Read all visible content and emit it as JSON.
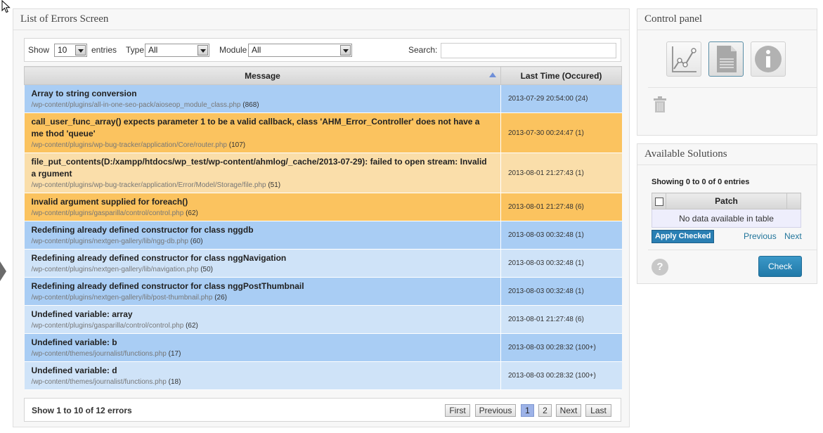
{
  "errors_panel": {
    "title": "List of Errors Screen",
    "show_label": "Show",
    "entries_value": "10",
    "entries_label": "entries",
    "type_label": "Type",
    "type_value": "All",
    "module_label": "Module",
    "module_value": "All",
    "search_label": "Search:",
    "search_value": "",
    "columns": [
      "Message",
      "Last Time (Occured)"
    ],
    "rows": [
      {
        "title": "Array to string conversion",
        "path": "/wp-content/plugins/all-in-one-seo-pack/aioseop_module_class.php",
        "line": "(868)",
        "time": "2013-07-29 20:54:00 (24)"
      },
      {
        "title": "call_user_func_array() expects parameter 1 to be a valid callback, class 'AHM_Error_Controller' does not have a me thod 'queue'",
        "path": "/wp-content/plugins/wp-bug-tracker/application/Core/router.php",
        "line": "(107)",
        "time": "2013-07-30 00:24:47 (1)"
      },
      {
        "title": "file_put_contents(D:/xampp/htdocs/wp_test/wp-content/ahmlog/_cache/2013-07-29): failed to open stream: Invalid a rgument",
        "path": "/wp-content/plugins/wp-bug-tracker/application/Error/Model/Storage/file.php",
        "line": "(51)",
        "time": "2013-08-01 21:27:43 (1)"
      },
      {
        "title": "Invalid argument supplied for foreach()",
        "path": "/wp-content/plugins/gasparilla/control/control.php",
        "line": "(62)",
        "time": "2013-08-01 21:27:48 (6)"
      },
      {
        "title": "Redefining already defined constructor for class nggdb",
        "path": "/wp-content/plugins/nextgen-gallery/lib/ngg-db.php",
        "line": "(60)",
        "time": "2013-08-03 00:32:48 (1)"
      },
      {
        "title": "Redefining already defined constructor for class nggNavigation",
        "path": "/wp-content/plugins/nextgen-gallery/lib/navigation.php",
        "line": "(50)",
        "time": "2013-08-03 00:32:48 (1)"
      },
      {
        "title": "Redefining already defined constructor for class nggPostThumbnail",
        "path": "/wp-content/plugins/nextgen-gallery/lib/post-thumbnail.php",
        "line": "(26)",
        "time": "2013-08-03 00:32:48 (1)"
      },
      {
        "title": "Undefined variable: array",
        "path": "/wp-content/plugins/gasparilla/control/control.php",
        "line": "(62)",
        "time": "2013-08-01 21:27:48 (6)"
      },
      {
        "title": "Undefined variable: b",
        "path": "/wp-content/themes/journalist/functions.php",
        "line": "(17)",
        "time": "2013-08-03 00:28:32 (100+)"
      },
      {
        "title": "Undefined variable: d",
        "path": "/wp-content/themes/journalist/functions.php",
        "line": "(18)",
        "time": "2013-08-03 00:28:32 (100+)"
      }
    ],
    "footer_info": "Show 1 to 10 of 12 errors",
    "pagination": {
      "first": "First",
      "previous": "Previous",
      "pages": [
        "1",
        "2"
      ],
      "next": "Next",
      "last": "Last"
    }
  },
  "control_panel": {
    "title": "Control panel",
    "icons": [
      "chart-icon",
      "document-icon",
      "info-icon",
      "trash-icon"
    ]
  },
  "solutions_panel": {
    "title": "Available Solutions",
    "info": "Showing 0 to 0 of 0 entries",
    "column": "Patch",
    "empty": "No data available in table",
    "apply_label": "Apply Checked",
    "previous": "Previous",
    "next": "Next",
    "help_glyph": "?",
    "check_label": "Check"
  },
  "colors": {
    "row_blue": "#a9cdf4",
    "row_light_blue": "#cfe3f8",
    "row_orange": "#fbc35f",
    "row_light_orange": "#fadeaa",
    "accent_button": "#2a7fb3"
  }
}
